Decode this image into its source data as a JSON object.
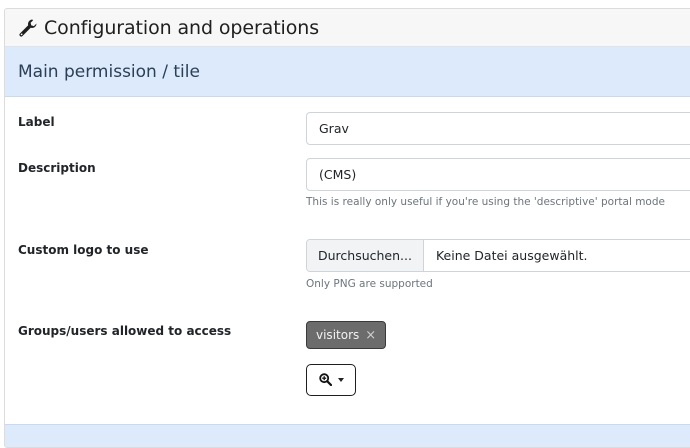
{
  "header": {
    "title": "Configuration and operations",
    "icon": "wrench-icon"
  },
  "section": {
    "title": "Main permission / tile"
  },
  "fields": {
    "label": {
      "label": "Label",
      "value": "Grav"
    },
    "description": {
      "label": "Description",
      "value": "(CMS)",
      "help": "This is really only useful if you're using the 'descriptive' portal mode"
    },
    "logo": {
      "label": "Custom logo to use",
      "browse": "Durchsuchen...",
      "filename": "Keine Datei ausgewählt.",
      "help": "Only PNG are supported"
    },
    "groups": {
      "label": "Groups/users allowed to access",
      "tags": [
        "visitors"
      ],
      "remove_glyph": "×",
      "search_icon": "search-plus-icon"
    }
  }
}
